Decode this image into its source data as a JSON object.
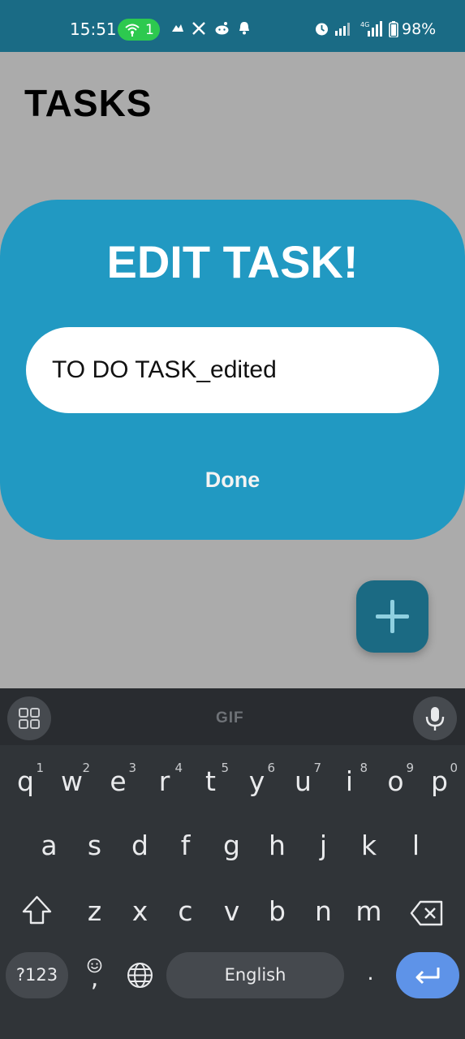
{
  "status_bar": {
    "time": "15:51",
    "hotspot_count": "1",
    "battery": "98%",
    "network_label": "4G",
    "accent_color": "#2dc94f"
  },
  "app": {
    "title": "TASKS"
  },
  "dialog": {
    "title": "EDIT TASK!",
    "input_value": "TO DO TASK_edited",
    "done_label": "Done",
    "color": "#2199c2"
  },
  "fab": {
    "icon": "plus-icon",
    "color": "#1b6a83"
  },
  "keyboard": {
    "toolbar_gif": "GIF",
    "row1": [
      {
        "key": "q",
        "alt": "1"
      },
      {
        "key": "w",
        "alt": "2"
      },
      {
        "key": "e",
        "alt": "3"
      },
      {
        "key": "r",
        "alt": "4"
      },
      {
        "key": "t",
        "alt": "5"
      },
      {
        "key": "y",
        "alt": "6"
      },
      {
        "key": "u",
        "alt": "7"
      },
      {
        "key": "i",
        "alt": "8"
      },
      {
        "key": "o",
        "alt": "9"
      },
      {
        "key": "p",
        "alt": "0"
      }
    ],
    "row2": [
      "a",
      "s",
      "d",
      "f",
      "g",
      "h",
      "j",
      "k",
      "l"
    ],
    "row3": [
      "z",
      "x",
      "c",
      "v",
      "b",
      "n",
      "m"
    ],
    "symbols_label": "?123",
    "comma_label": ",",
    "space_label": "English",
    "period_label": ".",
    "enter_color": "#5e93e8"
  }
}
